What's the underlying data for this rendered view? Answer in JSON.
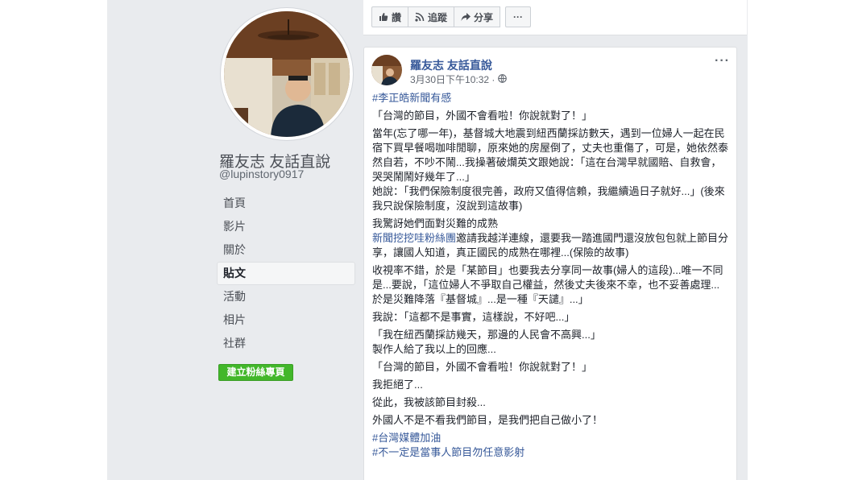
{
  "page": {
    "name": "羅友志 友話直說",
    "handle": "@lupinstory0917"
  },
  "nav": {
    "items": [
      "首頁",
      "影片",
      "關於",
      "貼文",
      "活動",
      "相片",
      "社群"
    ],
    "active": "貼文"
  },
  "create_page_button": "建立粉絲專頁",
  "actions": {
    "like": "讚",
    "follow": "追蹤",
    "share": "分享",
    "more": "···"
  },
  "post": {
    "author": "羅友志 友話直說",
    "timestamp": "3月30日下午10:32 ·",
    "menu": "···",
    "hashtag_top": "#李正皓新聞有感",
    "p1": "「台灣的節目，外國不會看啦！你說就對了！」",
    "p2": "當年(忘了哪一年)，基督城大地震到紐西蘭採訪數天，遇到一位婦人一起在民宿下買早餐喝咖啡閒聊，原來她的房屋倒了，丈夫也重傷了，可是，她依然泰然自若，不吵不鬧...我操著破爛英文跟她說：「這在台灣早就國賠、自救會，哭哭鬧鬧好幾年了...」",
    "p3": "她說：「我們保險制度很完善，政府又值得信賴，我繼續過日子就好...」(後來我只說保險制度，沒說到這故事)",
    "p4": "我驚訝她們面對災難的成熟",
    "p5_link": "新聞挖挖哇粉絲團",
    "p5_rest": "邀請我越洋連線，還要我一踏進國門還沒放包包就上節目分享，讓國人知道，真正國民的成熟在哪裡...(保險的故事)",
    "p6": "收視率不錯，於是「某節目」也要我去分享同一故事(婦人的這段)...唯一不同是...要說，「這位婦人不爭取自己權益，然後丈夫後來不幸，也不妥善處理...於是災難降落『基督城』...是一種『天譴』...」",
    "p7": "我說：「這都不是事實，這樣說，不好吧...」",
    "p8a": "「我在紐西蘭採訪幾天，那邊的人民會不高興...」",
    "p8b": "製作人給了我以上的回應...",
    "p9": "「台灣的節目，外國不會看啦！你說就對了！」",
    "p10": "我拒絕了...",
    "p11": "從此，我被該節目封殺...",
    "p12": "外國人不是不看我們節目，是我們把自己做小了！",
    "hashtag_1": "#台灣媒體加油",
    "hashtag_2": "#不一定是當事人節目勿任意影射"
  },
  "colors": {
    "background": "#e9ebee",
    "link": "#365899",
    "create_button": "#42b72a"
  },
  "icons": [
    "thumbs-up-icon",
    "rss-icon",
    "share-arrow-icon",
    "globe-icon",
    "more-dots-icon"
  ]
}
